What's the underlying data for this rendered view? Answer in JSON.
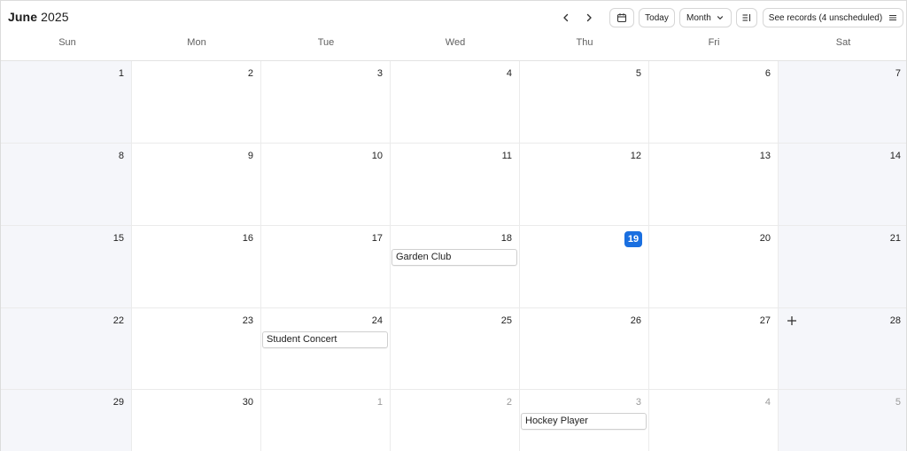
{
  "header": {
    "month": "June",
    "year": "2025",
    "prev_icon": "chevron-left-icon",
    "next_icon": "chevron-right-icon",
    "date_picker_icon": "calendar-icon",
    "today_label": "Today",
    "view_label": "Month",
    "view_icon": "chevron-down-icon",
    "filter_icon": "list-filter-icon",
    "records_label": "See records (4 unscheduled)",
    "records_icon": "hamburger-menu-icon"
  },
  "weekdays": [
    "Sun",
    "Mon",
    "Tue",
    "Wed",
    "Thu",
    "Fri",
    "Sat"
  ],
  "weeks": [
    [
      "1",
      "2",
      "3",
      "4",
      "5",
      "6",
      "7"
    ],
    [
      "8",
      "9",
      "10",
      "11",
      "12",
      "13",
      "14"
    ],
    [
      "15",
      "16",
      "17",
      "18",
      "19",
      "20",
      "21"
    ],
    [
      "22",
      "23",
      "24",
      "25",
      "26",
      "27",
      "28"
    ],
    [
      "29",
      "30",
      "1",
      "2",
      "3",
      "4",
      "5"
    ]
  ],
  "today": "19",
  "events": {
    "garden_club": "Garden Club",
    "student_concert": "Student Concert",
    "hockey_player": "Hockey Player"
  },
  "colors": {
    "accent": "#1a6fe0",
    "weekend_bg": "#f5f6fa",
    "outside_month_text": "#9a9a9a"
  },
  "add_icon": "plus-icon"
}
